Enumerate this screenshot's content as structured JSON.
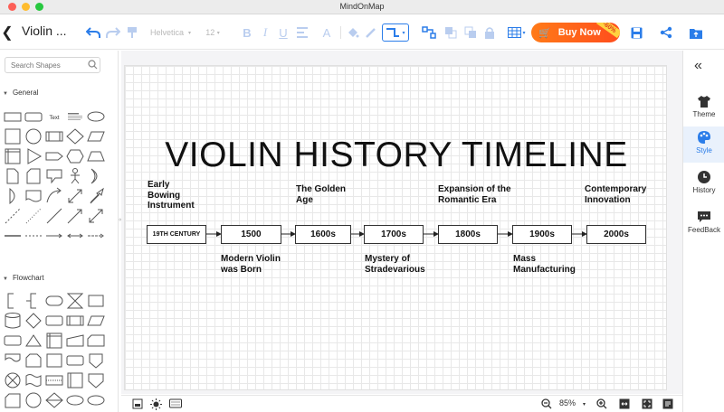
{
  "window": {
    "title": "MindOnMap"
  },
  "toolbar": {
    "doc_title": "Violin ...",
    "font_family": "Helvetica",
    "font_size": "12",
    "buy_label": "Buy Now",
    "buy_badge": "-60%"
  },
  "left_panel": {
    "search_placeholder": "Search Shapes",
    "sections": [
      {
        "label": "General"
      },
      {
        "label": "Flowchart"
      }
    ],
    "text_shape_label": "Text"
  },
  "canvas": {
    "title": "VIOLIN HISTORY TIMELINE",
    "boxes": [
      "19TH CENTURY",
      "1500",
      "1600s",
      "1700s",
      "1800s",
      "1900s",
      "2000s"
    ],
    "labels_top": [
      "Early\nBowing\nInstrument",
      "The Golden\nAge",
      "Expansion of the\nRomantic Era",
      "Contemporary\nInnovation"
    ],
    "labels_bottom": [
      "Modern Violin\nwas Born",
      "Mystery of\nStradevarious",
      "Mass\nManufacturing"
    ]
  },
  "right_panel": {
    "items": [
      {
        "label": "Theme",
        "icon": "shirt-icon"
      },
      {
        "label": "Style",
        "icon": "palette-icon"
      },
      {
        "label": "History",
        "icon": "clock-icon"
      },
      {
        "label": "FeedBack",
        "icon": "chat-icon"
      }
    ]
  },
  "status_bar": {
    "zoom": "85%"
  },
  "colors": {
    "accent": "#2b7de9",
    "buy_button": "#ff6a1a",
    "active_bg": "#e9f1fc"
  }
}
